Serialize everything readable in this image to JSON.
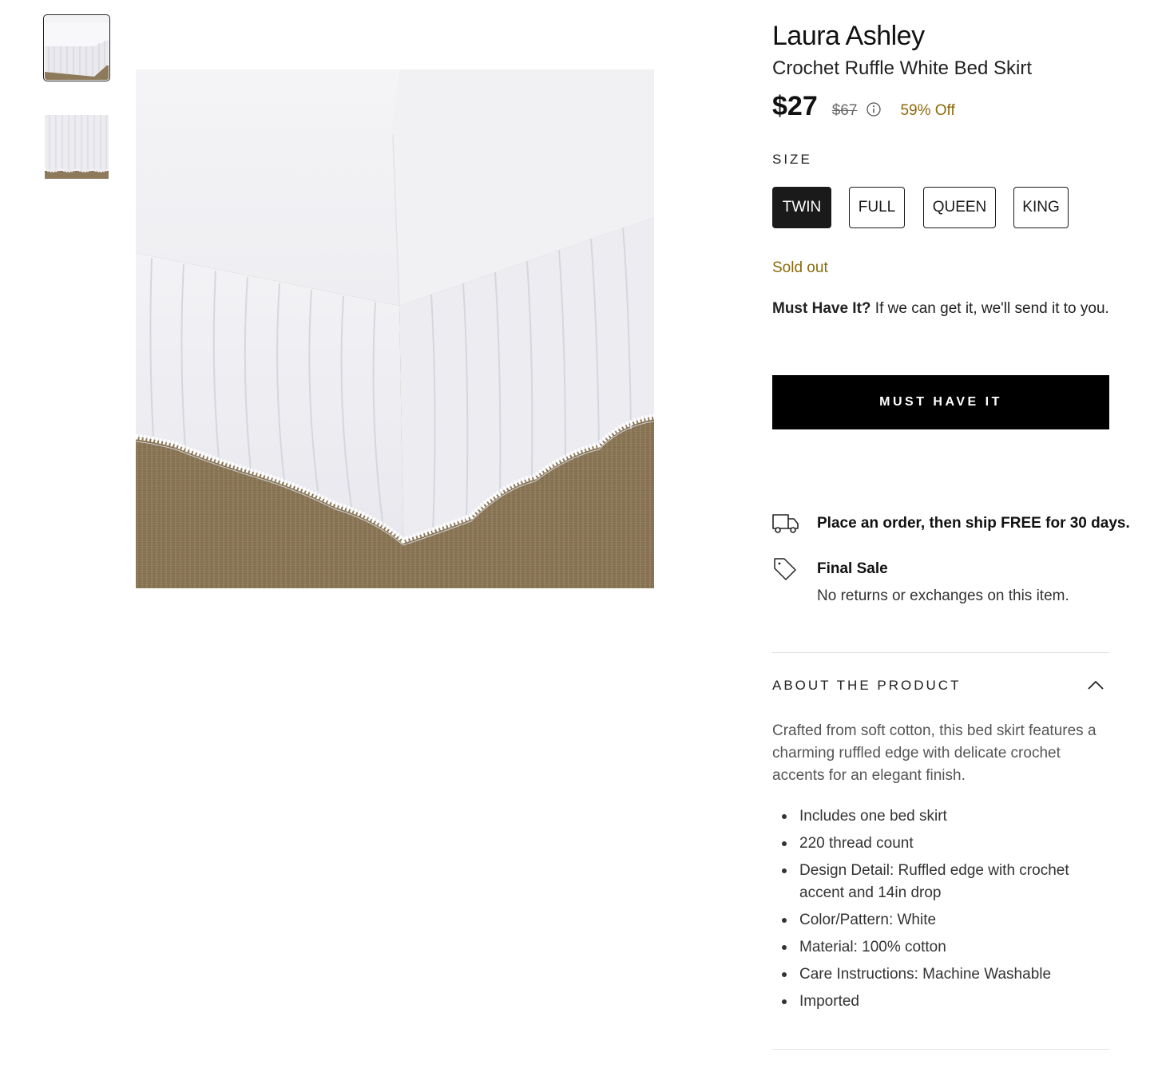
{
  "gallery": {
    "thumbnails": [
      {
        "alt": "Bed skirt corner view",
        "selected": true
      },
      {
        "alt": "Bed skirt ruffle detail",
        "selected": false
      }
    ],
    "main_image_alt": "Laura Ashley Crochet Ruffle White Bed Skirt"
  },
  "product": {
    "brand": "Laura Ashley",
    "name": "Crochet Ruffle White Bed Skirt",
    "price": "$27",
    "original_price": "$67",
    "discount": "59% Off"
  },
  "size": {
    "label": "SIZE",
    "options": [
      "TWIN",
      "FULL",
      "QUEEN",
      "KING"
    ],
    "selected": "TWIN"
  },
  "availability": {
    "status": "Sold out",
    "must_have_bold": "Must Have It?",
    "must_have_text": " If we can get it, we'll send it to you.",
    "button_label": "MUST HAVE IT"
  },
  "shipping": {
    "icon": "truck-icon",
    "text": "Place an order, then ship FREE for 30 days."
  },
  "final_sale": {
    "icon": "tag-icon",
    "title": "Final Sale",
    "description": "No returns or exchanges on this item."
  },
  "about": {
    "title": "ABOUT THE PRODUCT",
    "expanded": true,
    "description": "Crafted from soft cotton, this bed skirt features a charming ruffled edge with delicate crochet accents for an elegant finish.",
    "features": [
      "Includes one bed skirt",
      "220 thread count",
      "Design Detail: Ruffled edge with crochet accent and 14in drop",
      "Color/Pattern: White",
      "Material: 100% cotton",
      "Care Instructions: Machine Washable",
      "Imported"
    ]
  },
  "colors": {
    "accent_gold": "#8a6a0c",
    "button_black": "#000000",
    "floor_jute": "#8d7a5a"
  }
}
